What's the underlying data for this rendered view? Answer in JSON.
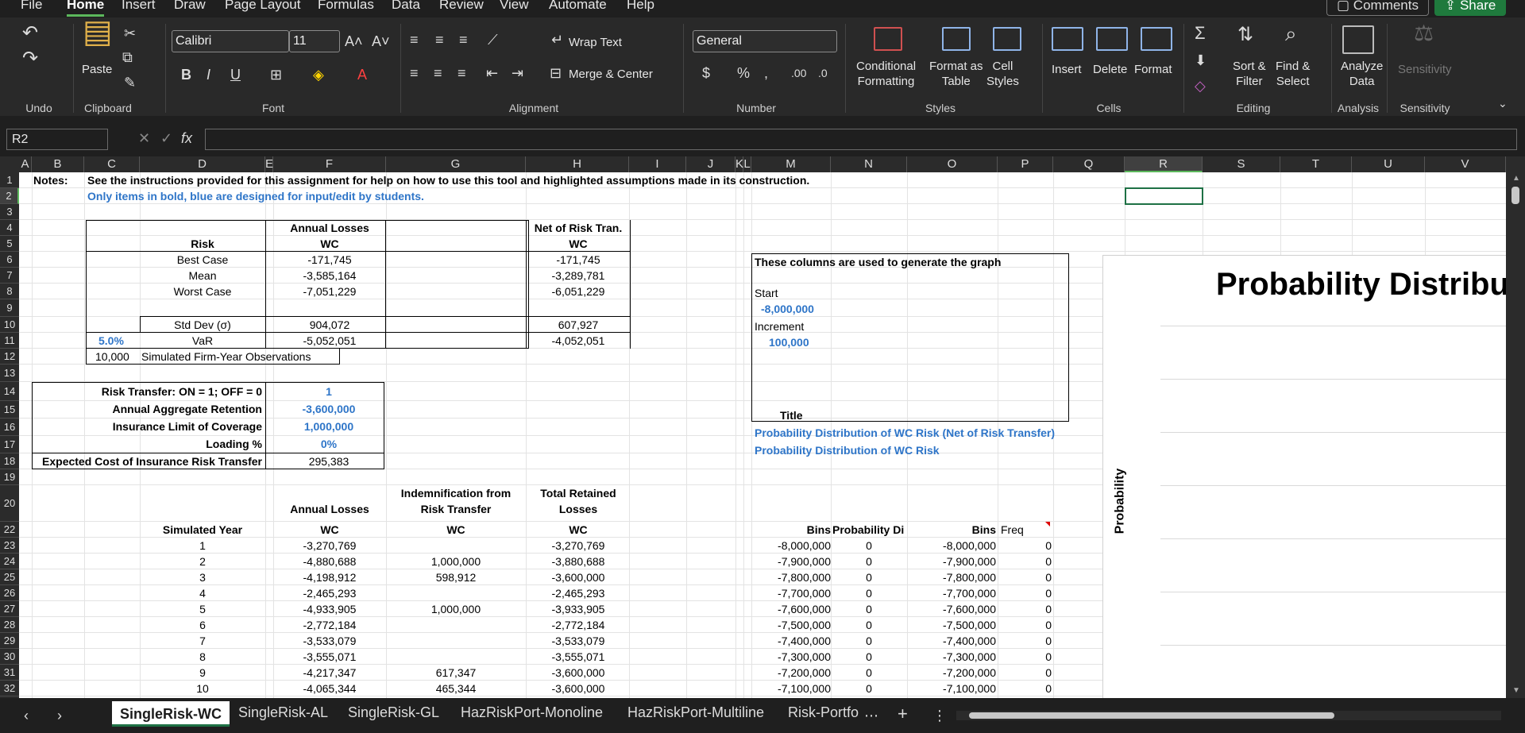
{
  "menu": {
    "tabs": [
      "File",
      "Home",
      "Insert",
      "Draw",
      "Page Layout",
      "Formulas",
      "Data",
      "Review",
      "View",
      "Automate",
      "Help"
    ],
    "comments": "Comments",
    "share": "Share"
  },
  "ribbon": {
    "paste": "Paste",
    "font_name": "Calibri",
    "font_size": "11",
    "wrap_text": "Wrap Text",
    "merge_center": "Merge & Center",
    "number_format": "General",
    "conditional": [
      "Conditional",
      "Formatting"
    ],
    "format_table": [
      "Format as",
      "Table"
    ],
    "cell_styles": [
      "Cell",
      "Styles"
    ],
    "insert": "Insert",
    "delete": "Delete",
    "format": "Format",
    "sort_filter": [
      "Sort &",
      "Filter"
    ],
    "find_select": [
      "Find &",
      "Select"
    ],
    "analyze": [
      "Analyze",
      "Data"
    ],
    "sensitivity": "Sensitivity",
    "groups": [
      "Undo",
      "Clipboard",
      "Font",
      "Alignment",
      "Number",
      "Styles",
      "Cells",
      "Editing",
      "Analysis",
      "Sensitivity"
    ]
  },
  "formula_bar": {
    "name_box": "R2",
    "fx": "fx",
    "value": ""
  },
  "columns": [
    "A",
    "B",
    "C",
    "D",
    "E",
    "F",
    "G",
    "H",
    "I",
    "J",
    "K",
    "L",
    "M",
    "N",
    "O",
    "P",
    "Q",
    "R",
    "S",
    "T",
    "U",
    "V"
  ],
  "rows": [
    "1",
    "2",
    "3",
    "4",
    "5",
    "6",
    "7",
    "8",
    "9",
    "10",
    "11",
    "12",
    "13",
    "14",
    "15",
    "16",
    "17",
    "18",
    "19",
    "20",
    "22",
    "23",
    "24",
    "25",
    "26",
    "27",
    "28",
    "29",
    "30",
    "31",
    "32"
  ],
  "sheet": {
    "notes_label": "Notes:",
    "note1": "See the instructions provided for this assignment  for help on how to use this tool and highlighted assumptions made in its construction.",
    "note2": "Only items in bold, blue are designed for input/edit by  students.",
    "annual_losses": "Annual Losses",
    "net_risk": "Net of Risk Tran.",
    "wc": "WC",
    "risk": "Risk",
    "best_case": "Best Case",
    "mean": "Mean",
    "worst_case": "Worst Case",
    "std_dev": "Std Dev (σ)",
    "var": "VaR",
    "var_pct": "5.0%",
    "f_best": "-171,745",
    "f_mean": "-3,585,164",
    "f_worst": "-7,051,229",
    "f_std": "904,072",
    "f_var": "-5,052,051",
    "h_best": "-171,745",
    "h_mean": "-3,289,781",
    "h_worst": "-6,051,229",
    "h_std": "607,927",
    "h_var": "-4,052,051",
    "sim_count": "10,000",
    "sim_label": "Simulated Firm-Year Observations",
    "rt_label": "Risk Transfer: ON = 1; OFF = 0",
    "rt_value": "1",
    "aar_label": "Annual Aggregate Retention",
    "aar_value": "-3,600,000",
    "ilc_label": "Insurance Limit of Coverage",
    "ilc_value": "1,000,000",
    "loading_label": "Loading %",
    "loading_value": "0%",
    "ecost_label": "Expected Cost of Insurance Risk Transfer",
    "ecost_value": "295,383",
    "graph_note": "These columns are used to generate the graph",
    "start": "Start",
    "start_value": "-8,000,000",
    "increment": "Increment",
    "increment_value": "100,000",
    "title_label": "Title",
    "title1": "Probability Distribution of WC Risk (Net of Risk Transfer)",
    "title2": "Probability Distribution of WC Risk",
    "indem_l1": "Indemnification from",
    "indem_l2": "Risk Transfer",
    "total_l1": "Total Retained",
    "total_l2": "Losses",
    "sim_year": "Simulated Year",
    "bins": "Bins",
    "prob_di": "Probability Di",
    "freq": "Freq",
    "table": [
      {
        "y": "1",
        "f": "-3,270,769",
        "g": "",
        "h": "-3,270,769",
        "m": "-8,000,000",
        "n": "0",
        "o": "-8,000,000",
        "p": "0"
      },
      {
        "y": "2",
        "f": "-4,880,688",
        "g": "1,000,000",
        "h": "-3,880,688",
        "m": "-7,900,000",
        "n": "0",
        "o": "-7,900,000",
        "p": "0"
      },
      {
        "y": "3",
        "f": "-4,198,912",
        "g": "598,912",
        "h": "-3,600,000",
        "m": "-7,800,000",
        "n": "0",
        "o": "-7,800,000",
        "p": "0"
      },
      {
        "y": "4",
        "f": "-2,465,293",
        "g": "",
        "h": "-2,465,293",
        "m": "-7,700,000",
        "n": "0",
        "o": "-7,700,000",
        "p": "0"
      },
      {
        "y": "5",
        "f": "-4,933,905",
        "g": "1,000,000",
        "h": "-3,933,905",
        "m": "-7,600,000",
        "n": "0",
        "o": "-7,600,000",
        "p": "0"
      },
      {
        "y": "6",
        "f": "-2,772,184",
        "g": "",
        "h": "-2,772,184",
        "m": "-7,500,000",
        "n": "0",
        "o": "-7,500,000",
        "p": "0"
      },
      {
        "y": "7",
        "f": "-3,533,079",
        "g": "",
        "h": "-3,533,079",
        "m": "-7,400,000",
        "n": "0",
        "o": "-7,400,000",
        "p": "0"
      },
      {
        "y": "8",
        "f": "-3,555,071",
        "g": "",
        "h": "-3,555,071",
        "m": "-7,300,000",
        "n": "0",
        "o": "-7,300,000",
        "p": "0"
      },
      {
        "y": "9",
        "f": "-4,217,347",
        "g": "617,347",
        "h": "-3,600,000",
        "m": "-7,200,000",
        "n": "0",
        "o": "-7,200,000",
        "p": "0"
      },
      {
        "y": "10",
        "f": "-4,065,344",
        "g": "465,344",
        "h": "-3,600,000",
        "m": "-7,100,000",
        "n": "0",
        "o": "-7,100,000",
        "p": "0"
      }
    ],
    "chart_title": "Probability Distributi",
    "chart_ylabel": "Probability"
  },
  "sheet_tabs": [
    "SingleRisk-WC",
    "SingleRisk-AL",
    "SingleRisk-GL",
    "HazRiskPort-Monoline",
    "HazRiskPort-Multiline",
    "Risk-Portfo"
  ]
}
